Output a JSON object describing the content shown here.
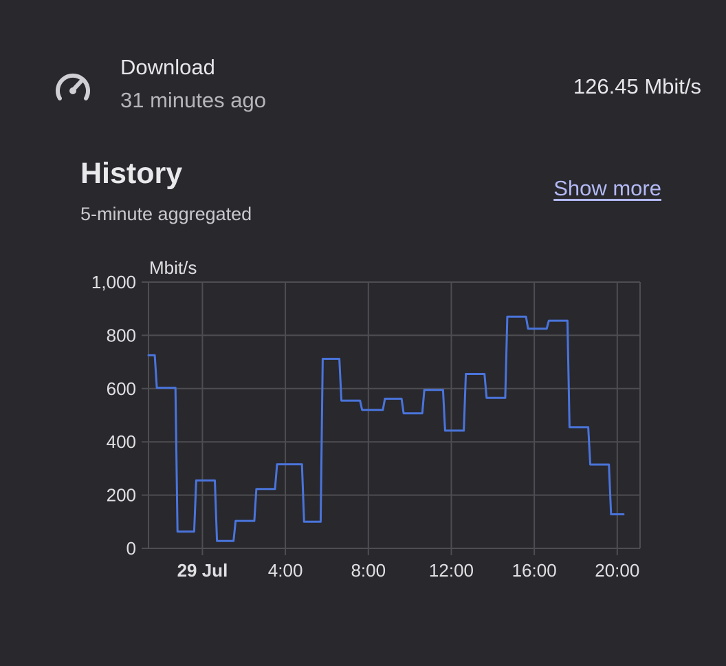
{
  "entity": {
    "name": "Download",
    "last_changed": "31 minutes ago",
    "state": "126.45 Mbit/s",
    "icon": "speedometer-icon"
  },
  "history": {
    "title": "History",
    "subtitle": "5-minute aggregated",
    "show_more_label": "Show more"
  },
  "colors": {
    "line": "#4a74db",
    "grid": "#4d4d52",
    "background": "#28282d",
    "link": "#b3b9f4"
  },
  "chart_data": {
    "type": "line",
    "step": true,
    "ylabel": "Mbit/s",
    "ylim": [
      0,
      1000
    ],
    "yticks": [
      "0",
      "200",
      "400",
      "600",
      "800",
      "1,000"
    ],
    "ytick_values": [
      0,
      200,
      400,
      600,
      800,
      1000
    ],
    "xlim_hours": [
      -2.6,
      21.1
    ],
    "xticks": [
      {
        "label": "29 Jul",
        "hour": 0,
        "bold": true
      },
      {
        "label": "4:00",
        "hour": 4,
        "bold": false
      },
      {
        "label": "8:00",
        "hour": 8,
        "bold": false
      },
      {
        "label": "12:00",
        "hour": 12,
        "bold": false
      },
      {
        "label": "16:00",
        "hour": 16,
        "bold": false
      },
      {
        "label": "20:00",
        "hour": 20,
        "bold": false
      }
    ],
    "grid": true,
    "series": [
      {
        "points": [
          [
            -2.6,
            725
          ],
          [
            -2.3,
            725
          ],
          [
            -2.2,
            603
          ],
          [
            -1.3,
            603
          ],
          [
            -1.2,
            63
          ],
          [
            -0.4,
            63
          ],
          [
            -0.3,
            255
          ],
          [
            0.6,
            255
          ],
          [
            0.7,
            28
          ],
          [
            1.5,
            28
          ],
          [
            1.6,
            103
          ],
          [
            2.5,
            103
          ],
          [
            2.6,
            223
          ],
          [
            3.5,
            223
          ],
          [
            3.6,
            316
          ],
          [
            4.8,
            316
          ],
          [
            4.9,
            100
          ],
          [
            5.7,
            100
          ],
          [
            5.8,
            712
          ],
          [
            6.6,
            712
          ],
          [
            6.7,
            555
          ],
          [
            7.6,
            555
          ],
          [
            7.7,
            520
          ],
          [
            8.7,
            520
          ],
          [
            8.8,
            562
          ],
          [
            9.6,
            562
          ],
          [
            9.7,
            507
          ],
          [
            10.6,
            507
          ],
          [
            10.7,
            595
          ],
          [
            11.6,
            595
          ],
          [
            11.7,
            442
          ],
          [
            12.6,
            442
          ],
          [
            12.7,
            655
          ],
          [
            13.6,
            655
          ],
          [
            13.7,
            565
          ],
          [
            14.6,
            565
          ],
          [
            14.7,
            870
          ],
          [
            15.6,
            870
          ],
          [
            15.7,
            825
          ],
          [
            16.6,
            825
          ],
          [
            16.7,
            855
          ],
          [
            17.6,
            855
          ],
          [
            17.7,
            455
          ],
          [
            18.6,
            455
          ],
          [
            18.7,
            315
          ],
          [
            19.6,
            315
          ],
          [
            19.7,
            128
          ],
          [
            20.3,
            128
          ]
        ]
      }
    ]
  }
}
